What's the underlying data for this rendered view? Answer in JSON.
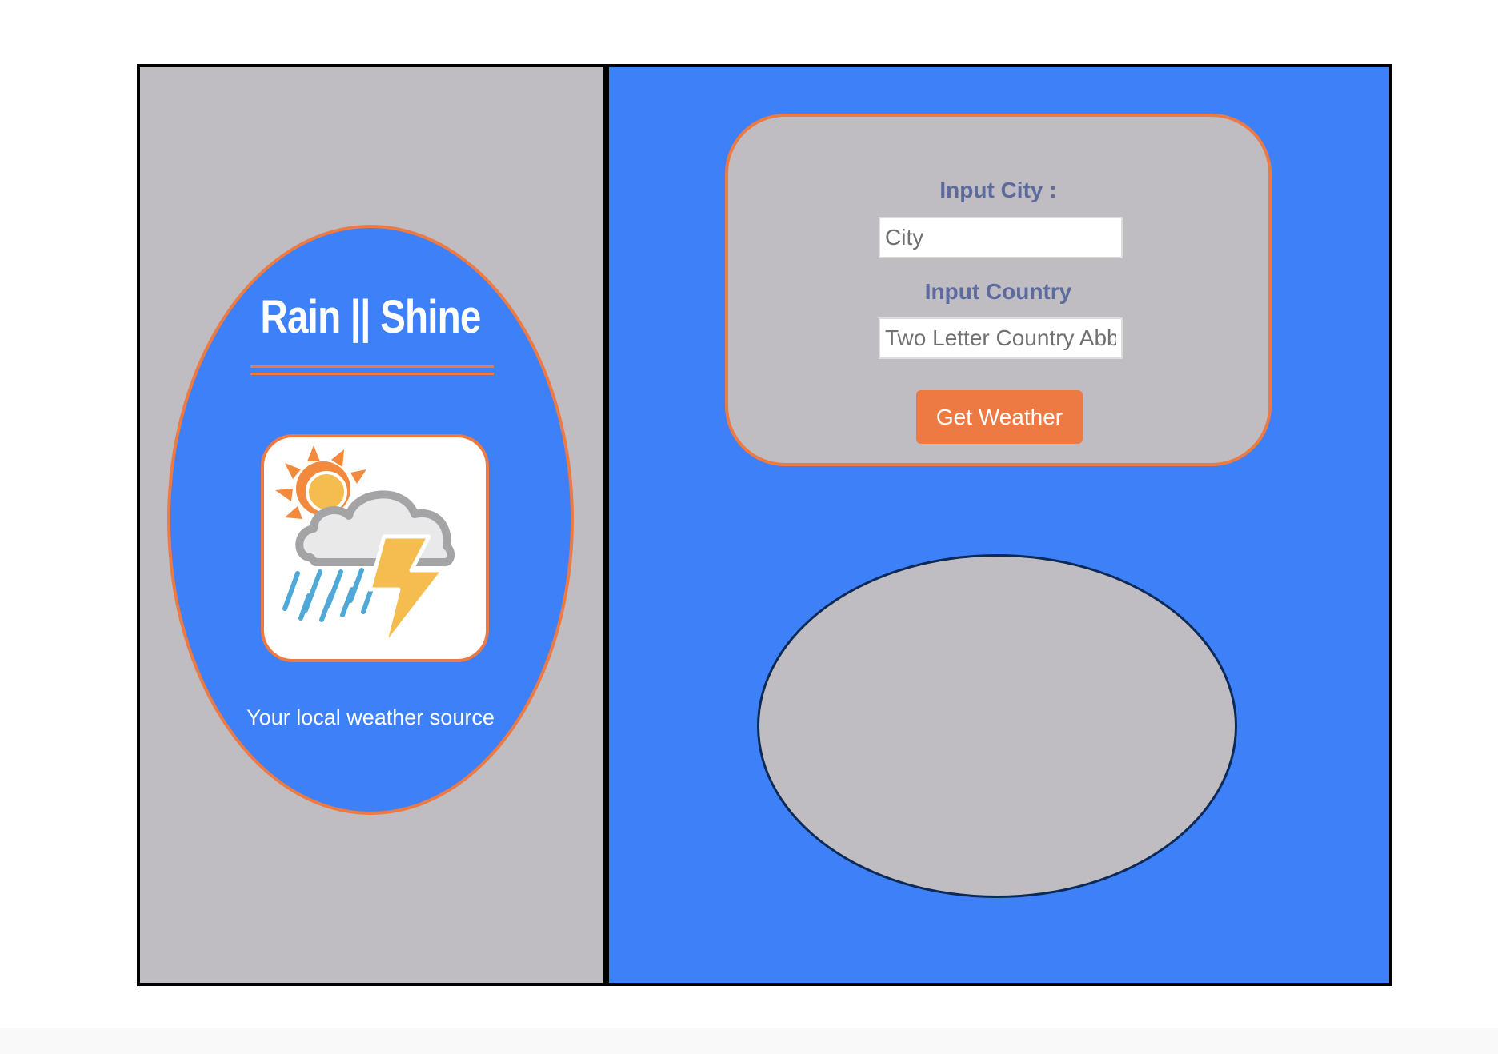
{
  "brand": {
    "title": "Rain || Shine",
    "tagline": "Your local weather source",
    "logo_icon": "sun-cloud-rain-lightning-icon"
  },
  "form": {
    "city_label": "Input City :",
    "city_placeholder": "City",
    "city_value": "",
    "country_label": "Input Country",
    "country_placeholder": "Two Letter Country Abbreviation",
    "country_value": "",
    "submit_label": "Get Weather"
  },
  "result": {
    "text": ""
  },
  "colors": {
    "panel_gray": "#bfbdc2",
    "primary_blue": "#3e80f7",
    "accent_orange": "#ee7a43",
    "label_slate": "#5c6b9c",
    "frame_black": "#000000",
    "result_border": "#0c2a55"
  }
}
